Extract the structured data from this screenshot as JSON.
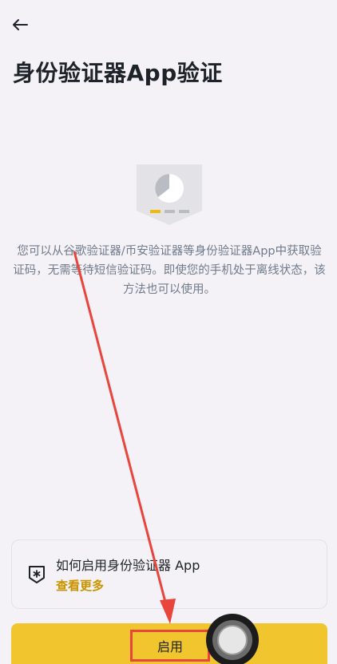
{
  "header": {
    "back_icon": "arrow-left-icon",
    "title": "身份验证器App验证"
  },
  "hero": {
    "icon": "authenticator-shield-illustration"
  },
  "description": "您可以从谷歌验证器/币安验证器等身份验证器App中获取验证码，无需等待短信验证码。即使您的手机处于离线状态，该方法也可以使用。",
  "help_card": {
    "icon": "authenticator-badge-icon",
    "title": "如何启用身份验证器 App",
    "link": "查看更多"
  },
  "primary_button": {
    "label": "启用"
  },
  "colors": {
    "accent": "#f0c52e",
    "link": "#c99400",
    "annotation_red": "#e8453c"
  }
}
